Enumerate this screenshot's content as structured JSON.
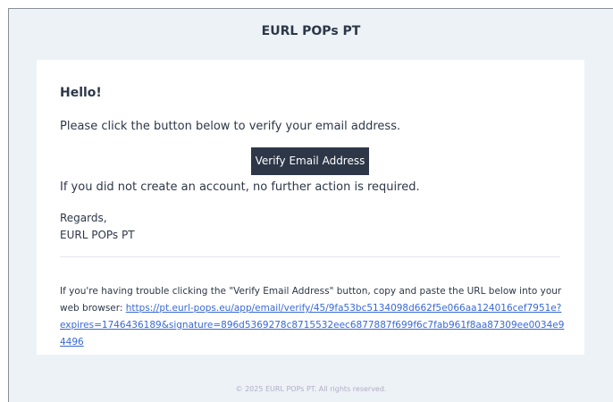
{
  "header": {
    "title": "EURL POPs PT"
  },
  "body": {
    "greeting": "Hello!",
    "intro_line": "Please click the button below to verify your email address.",
    "verify_button_label": "Verify Email Address",
    "outro_line": "If you did not create an account, no further action is required.",
    "salutation": "Regards,",
    "signature": "EURL POPs PT",
    "subcopy_text": "If you're having trouble clicking the \"Verify Email Address\" button, copy and paste the URL below into your web browser: ",
    "verify_url": "https://pt.eurl-pops.eu/app/email/verify/45/9fa53bc5134098d662f5e066aa124016cef7951e?expires=1746436189&signature=896d5369278c8715532eec6877887f699f6c7fab961f8aa87309ee0034e94496"
  },
  "footer": {
    "copyright": "© 2025 EURL POPs PT. All rights reserved."
  },
  "colors": {
    "background": "#edf2f7",
    "text": "#2d3748",
    "button": "#2d3748",
    "link": "#3869d4"
  }
}
